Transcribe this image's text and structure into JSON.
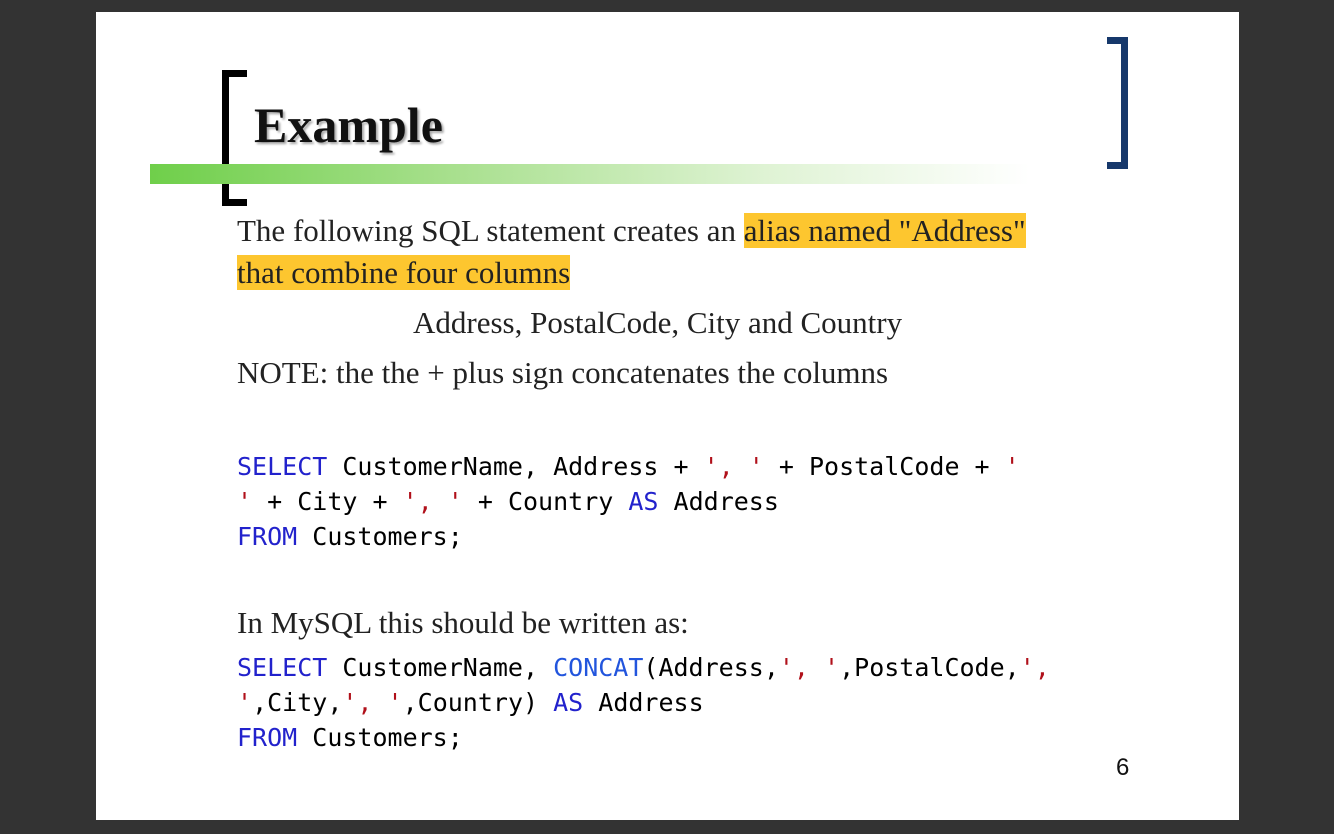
{
  "slide": {
    "title": "Example",
    "intro_plain": "The following SQL statement creates an ",
    "intro_highlight_1": "alias named \"Address\"",
    "intro_highlight_2": "that combine four columns",
    "columns_line": "Address, PostalCode, City and Country",
    "note": "NOTE: the the + plus sign concatenates the columns",
    "mysql_intro": "In MySQL this should be written as:",
    "page_number": "6",
    "highlight_color": "#fdc62f",
    "keyword_color": "#2222cc",
    "string_color": "#b0101a",
    "bracket_right_color": "#16386b"
  },
  "code1": {
    "l1_kw": "SELECT",
    "l1_a": " CustomerName, Address + ",
    "l1_s1": "', '",
    "l1_b": " + PostalCode + ",
    "l1_s2": "'",
    "l2_s1": "'",
    "l2_a": " + City + ",
    "l2_s2": "', '",
    "l2_b": " + Country ",
    "l2_kw": "AS",
    "l2_c": " Address",
    "l3_kw": "FROM",
    "l3_a": " Customers;"
  },
  "code2": {
    "l1_kw": "SELECT",
    "l1_a": " CustomerName, ",
    "l1_fn": "CONCAT",
    "l1_b": "(Address,",
    "l1_s1": "', '",
    "l1_c": ",PostalCode,",
    "l1_s2": "',",
    "l2_s1": "'",
    "l2_a": ",City,",
    "l2_s2": "', '",
    "l2_b": ",Country) ",
    "l2_kw": "AS",
    "l2_c": " Address",
    "l3_kw": "FROM",
    "l3_a": " Customers;"
  }
}
